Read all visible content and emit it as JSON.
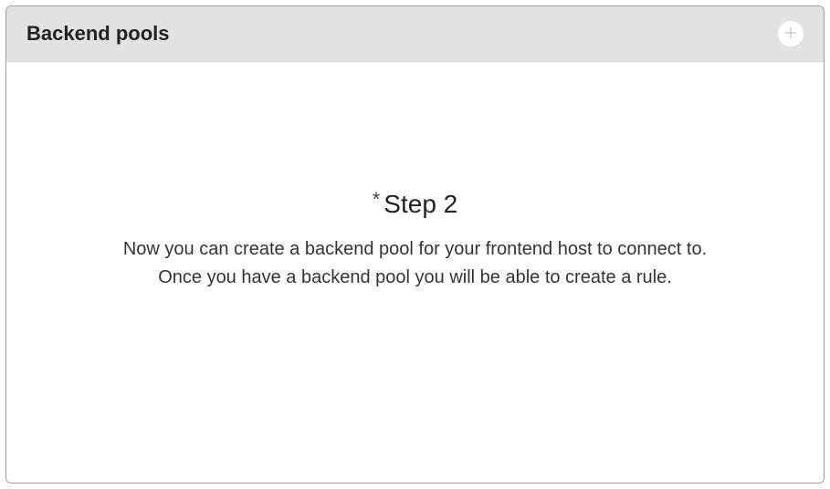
{
  "panel": {
    "title": "Backend pools",
    "add_button_label": "Add backend pool"
  },
  "step": {
    "asterisk": "*",
    "title": "Step 2",
    "description_line1": "Now you can create a backend pool for your frontend host to connect to.",
    "description_line2": "Once you have a backend pool you will be able to create a rule."
  }
}
